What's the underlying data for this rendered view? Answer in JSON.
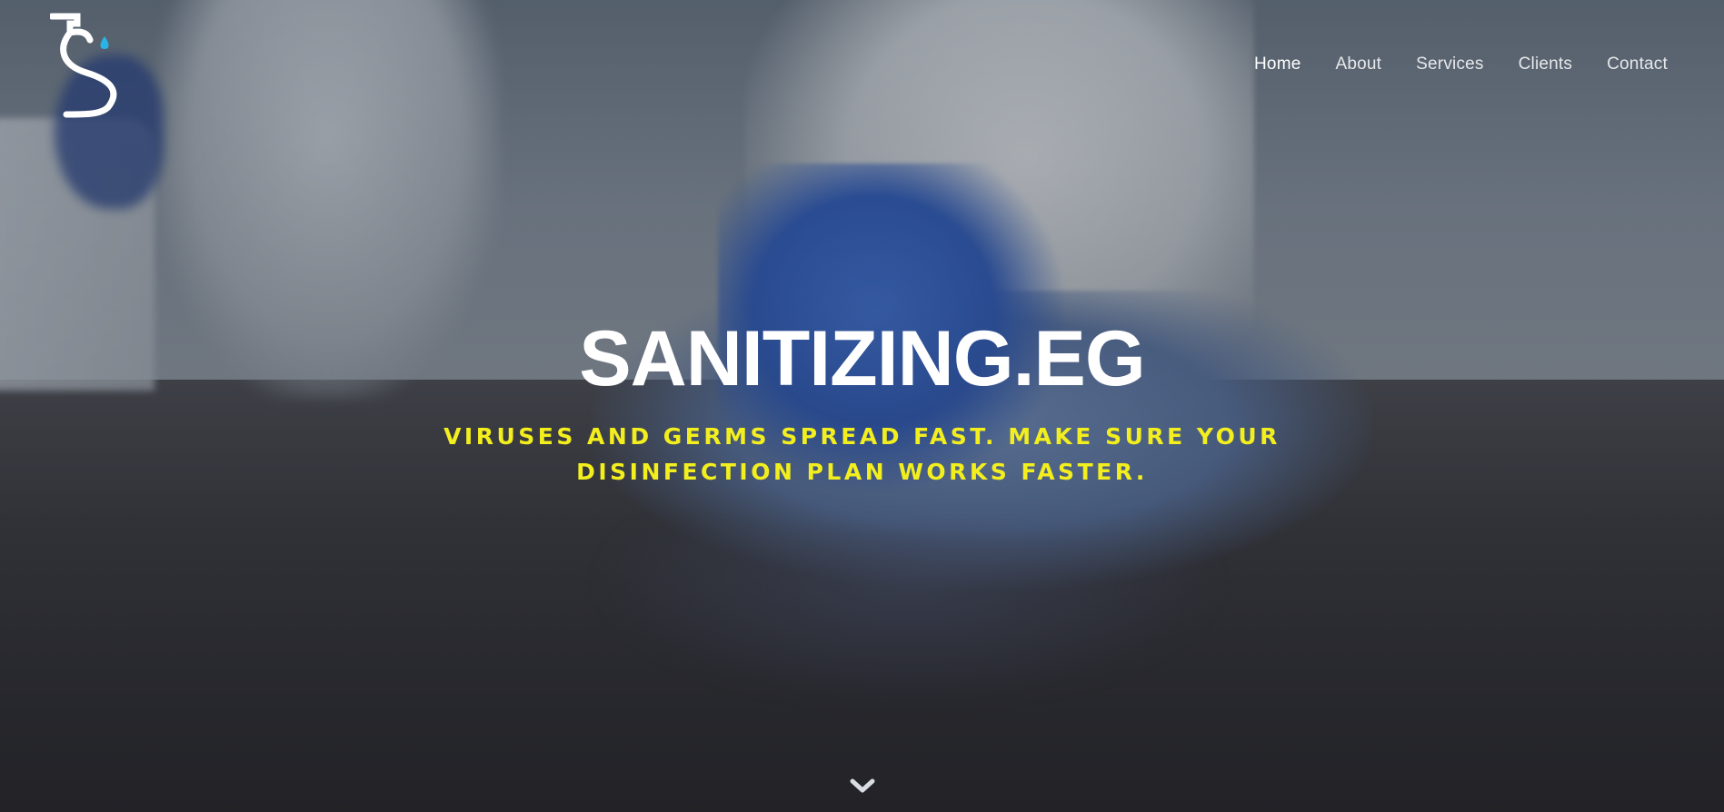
{
  "header": {
    "logo": {
      "icon": "spray-bottle-s-logo",
      "drop_color": "#2ab3e6"
    },
    "nav": [
      {
        "label": "Home",
        "active": true
      },
      {
        "label": "About",
        "active": false
      },
      {
        "label": "Services",
        "active": false
      },
      {
        "label": "Clients",
        "active": false
      },
      {
        "label": "Contact",
        "active": false
      }
    ]
  },
  "hero": {
    "title": "SANITIZING.EG",
    "subtitle_line1": "VIRUSES AND GERMS SPREAD FAST. MAKE SURE YOUR",
    "subtitle_line2": "DISINFECTION PLAN WORKS FASTER.",
    "subtitle_color": "#f3ee1d",
    "scroll_icon": "chevron-down-icon"
  }
}
